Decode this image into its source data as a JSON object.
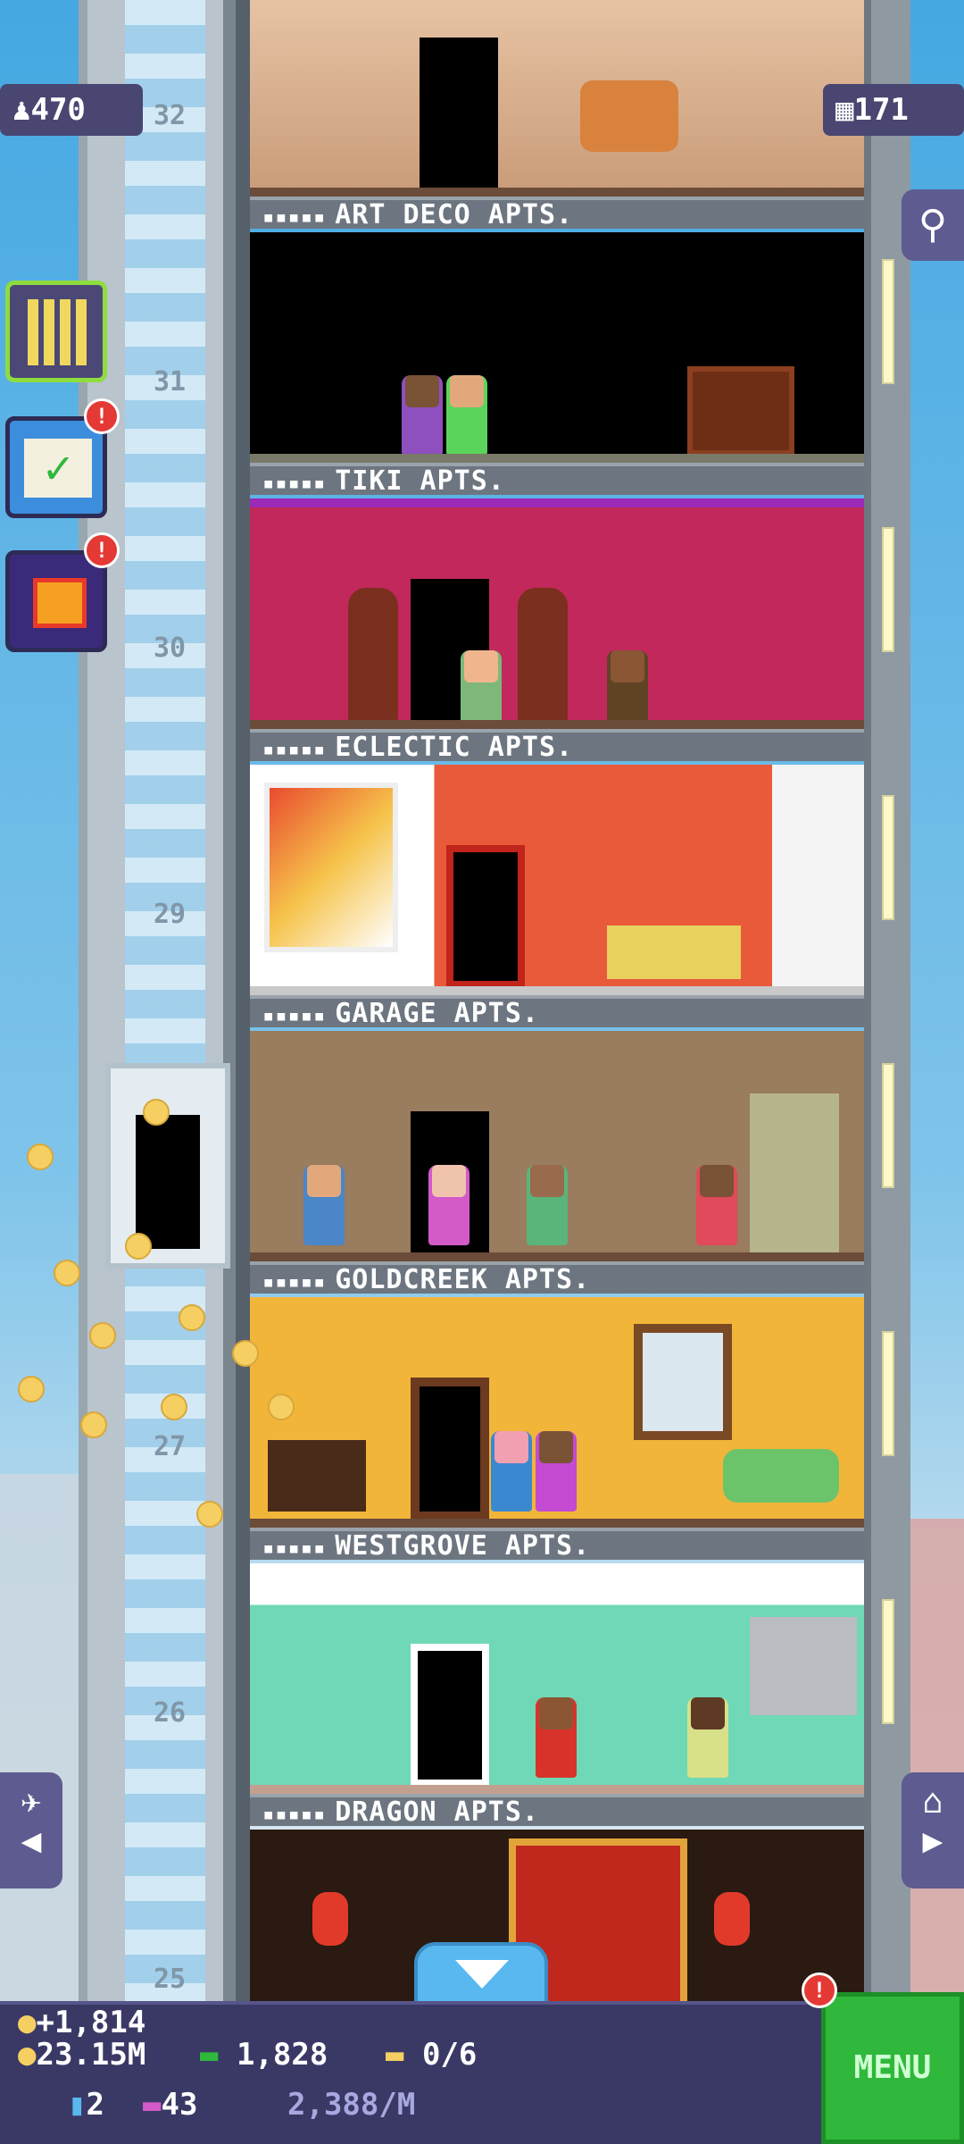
{
  "top_left_stat": {
    "icon": "citizen-icon",
    "value": "470"
  },
  "top_right_stat": {
    "icon": "floors-icon",
    "value": "171"
  },
  "floors": [
    {
      "label": "ART DECO APTS.",
      "number": "32"
    },
    {
      "label": "TIKI APTS.",
      "number": "31"
    },
    {
      "label": "ECLECTIC APTS.",
      "number": "30"
    },
    {
      "label": "GARAGE APTS.",
      "number": "29"
    },
    {
      "label": "GOLDCREEK APTS.",
      "number": ""
    },
    {
      "label": "WESTGROVE APTS.",
      "number": "27"
    },
    {
      "label": "DRAGON APTS.",
      "number": "26"
    },
    {
      "label": "",
      "number": "25"
    }
  ],
  "resident_slots": "▪▪▪▪▪",
  "side_buttons": [
    {
      "name": "build-floor-button",
      "badge": ""
    },
    {
      "name": "missions-button",
      "badge": "!"
    },
    {
      "name": "gift-button",
      "badge": "!"
    }
  ],
  "hud": {
    "income": "+1,814",
    "coins": "23.15M",
    "bux": "1,828",
    "tickets": "0/6",
    "elevator_count": "2",
    "vip_count": "43",
    "rate": "2,388/M",
    "menu_label": "MENU",
    "menu_badge": "!"
  },
  "colors": {
    "hud_bg": "#3a3966",
    "menu_green": "#2fb83b",
    "badge_red": "#e53935"
  }
}
